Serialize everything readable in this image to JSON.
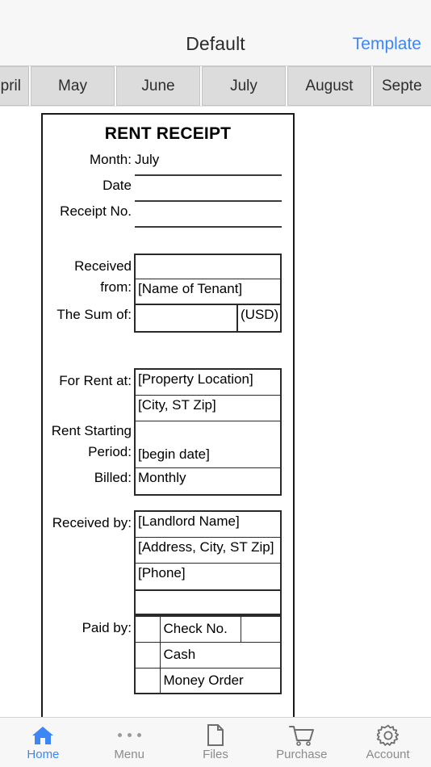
{
  "navbar": {
    "title": "Default",
    "right_action": "Template"
  },
  "month_tabs": [
    {
      "label": "April",
      "visible_label": "pril",
      "clipped": "left"
    },
    {
      "label": "May",
      "visible_label": "May",
      "clipped": "none"
    },
    {
      "label": "June",
      "visible_label": "June",
      "clipped": "none"
    },
    {
      "label": "July",
      "visible_label": "July",
      "clipped": "none"
    },
    {
      "label": "August",
      "visible_label": "August",
      "clipped": "none"
    },
    {
      "label": "September",
      "visible_label": "Septe",
      "clipped": "right"
    }
  ],
  "document": {
    "title": "RENT RECEIPT",
    "header_fields": [
      {
        "label": "Month:",
        "value": "July"
      },
      {
        "label": "Date",
        "value": ""
      },
      {
        "label": "Receipt No.",
        "value": ""
      }
    ],
    "received_from": {
      "label_line1": "Received",
      "label_line2": "from:",
      "row_empty": "",
      "row_name": "[Name of Tenant]"
    },
    "sum_of": {
      "label": "The Sum of:",
      "amount": "",
      "currency": "(USD)"
    },
    "rent_details": {
      "label_for_rent": "For Rent at:",
      "property_location": "[Property Location]",
      "city_state_zip": "[City, ST  Zip]",
      "label_period_line1": "Rent Starting",
      "label_period_line2": "Period:",
      "period_empty": "",
      "begin_date": "[begin date]",
      "label_billed": "Billed:",
      "billed": "Monthly"
    },
    "received_by": {
      "label": "Received by:",
      "landlord_name": "[Landlord Name]",
      "address": "[Address, City, ST  Zip]",
      "phone": "[Phone]",
      "blank": ""
    },
    "paid_by": {
      "label": "Paid by:",
      "rows": [
        {
          "check": "",
          "method": "Check No.",
          "value": ""
        },
        {
          "check": "",
          "method": "Cash",
          "value": ""
        },
        {
          "check": "",
          "method": "Money Order",
          "value": ""
        }
      ]
    }
  },
  "tabbar": {
    "items": [
      {
        "label": "Home",
        "icon": "home-icon",
        "active": true
      },
      {
        "label": "Menu",
        "icon": "dots-icon",
        "active": false
      },
      {
        "label": "Files",
        "icon": "file-icon",
        "active": false
      },
      {
        "label": "Purchase",
        "icon": "cart-icon",
        "active": false
      },
      {
        "label": "Account",
        "icon": "gear-icon",
        "active": false
      }
    ]
  },
  "colors": {
    "accent": "#3d86f5",
    "tab_inactive": "#8b8b8b",
    "chrome_bg": "#f7f7f7",
    "segment_bg": "#dcdcdc"
  }
}
